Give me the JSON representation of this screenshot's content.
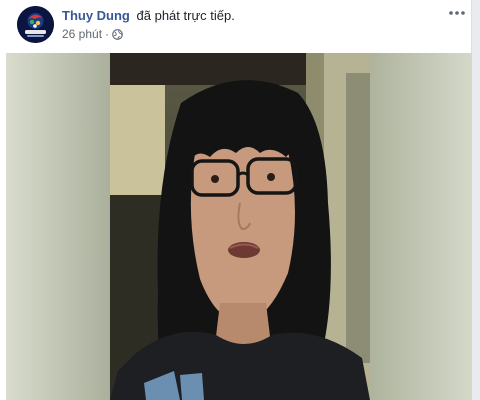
{
  "post": {
    "author": "Thuy Dung",
    "action": "đã phát trực tiếp.",
    "time": "26 phút",
    "separator": "·",
    "privacy_icon": "globe-icon",
    "menu_icon": "more-options-icon"
  },
  "video": {
    "type": "live-video",
    "subject": "person-speaking"
  },
  "colors": {
    "author_link": "#365899",
    "text": "#1d2129",
    "meta": "#616770",
    "page_bg": "#e9ebee"
  }
}
